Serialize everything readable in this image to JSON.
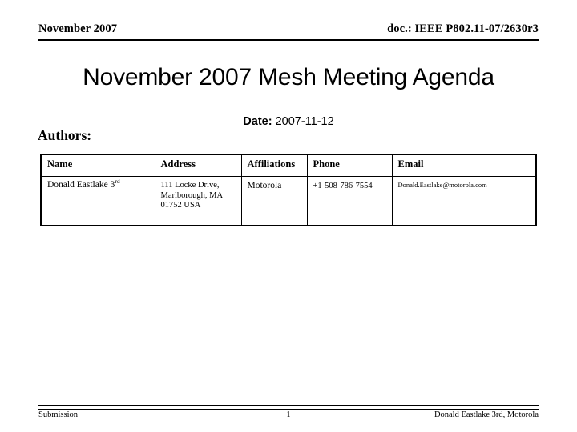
{
  "header": {
    "left_text": "November 2007",
    "right_text": "doc.: IEEE P802.11-07/2630r3"
  },
  "title": "November 2007 Mesh Meeting Agenda",
  "date": {
    "label": "Date:",
    "value": "2007-11-12"
  },
  "authors_section": {
    "label": "Authors:",
    "columns": [
      "Name",
      "Address",
      "Affiliations",
      "Phone",
      "Email"
    ],
    "rows": [
      {
        "name_text": "Donald Eastlake 3",
        "name_ordinal": "rd",
        "address_lines": [
          "111 Locke Drive,",
          "Marlborough, MA",
          "01752 USA"
        ],
        "affiliation": "Motorola",
        "phone": "+1-508-786-7554",
        "email": "Donald.Eastlake@motorola.com"
      }
    ]
  },
  "footer": {
    "left_text": "Submission",
    "page_number": "1",
    "right_text": "Donald Eastlake 3rd, Motorola"
  },
  "colors": {
    "text": "#000000",
    "background": "#ffffff",
    "rule": "#000000"
  }
}
